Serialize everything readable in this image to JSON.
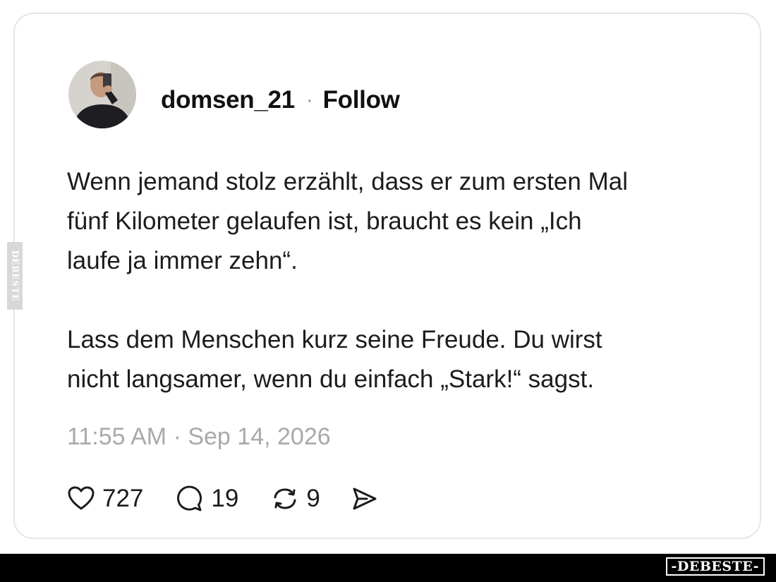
{
  "post": {
    "username": "domsen_21",
    "separator": "·",
    "follow_label": "Follow",
    "paragraphs": [
      "Wenn jemand stolz erzählt, dass er zum ersten Mal\nfünf Kilometer gelaufen ist, braucht es kein „Ich\nlaufe ja immer zehn“.",
      "Lass dem Menschen kurz seine Freude. Du wirst\nnicht langsamer, wenn du einfach „Stark!“ sagst."
    ],
    "timestamp": "11:55 AM · Sep 14, 2026"
  },
  "actions": {
    "likes": "727",
    "replies": "19",
    "reposts": "9",
    "like_icon": "heart-icon",
    "reply_icon": "speech-bubble-icon",
    "repost_icon": "repost-arrows-icon",
    "share_icon": "send-icon"
  },
  "watermark": {
    "side": "DEBESTE",
    "bottom": "-DEBESTE-"
  },
  "colors": {
    "text": "#1c1c1c",
    "muted": "#a9a9a9",
    "card_border": "#e6e6e6",
    "footer_bar": "#000000"
  }
}
